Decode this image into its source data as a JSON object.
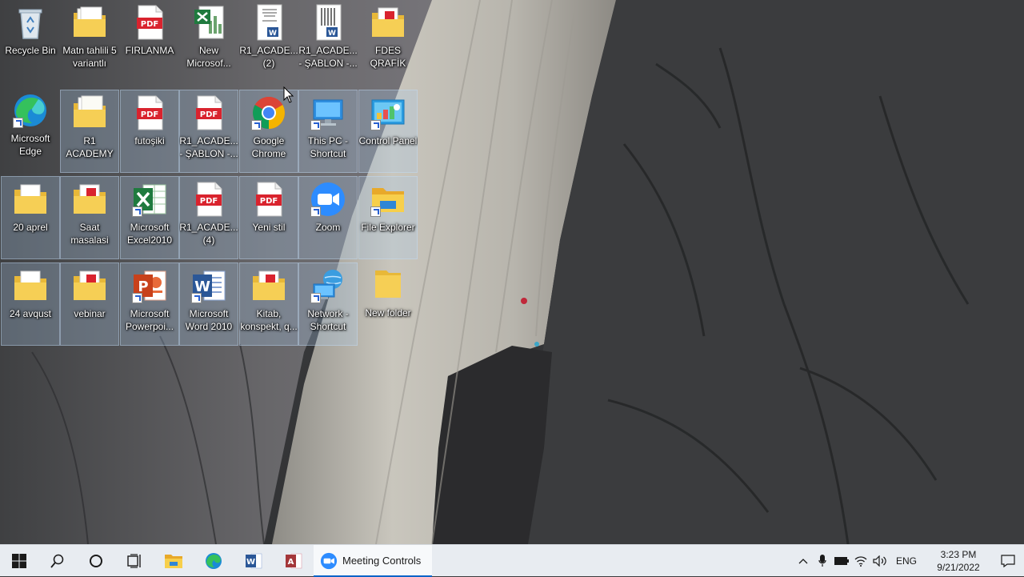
{
  "desktop": {
    "icons": [
      {
        "label": "Recycle Bin"
      },
      {
        "label": "Matn tahlili 5 variantlı"
      },
      {
        "label": "FIRLANMA"
      },
      {
        "label": "New Microsof..."
      },
      {
        "label": "R1_ACADE... (2)"
      },
      {
        "label": "R1_ACADE... - ŞABLON -..."
      },
      {
        "label": "FDES QRAFİK"
      },
      {
        "label": "Microsoft Edge"
      },
      {
        "label": "R1 ACADEMY"
      },
      {
        "label": "futoşiki"
      },
      {
        "label": "R1_ACADE... - ŞABLON -..."
      },
      {
        "label": "Google Chrome"
      },
      {
        "label": "This PC - Shortcut"
      },
      {
        "label": "Control Panel"
      },
      {
        "label": "20 aprel"
      },
      {
        "label": "Saat masalasi"
      },
      {
        "label": "Microsoft Excel2010"
      },
      {
        "label": "R1_ACADE... (4)"
      },
      {
        "label": "Yeni stil"
      },
      {
        "label": "Zoom"
      },
      {
        "label": "File Explorer"
      },
      {
        "label": "24 avqust"
      },
      {
        "label": "vebinar"
      },
      {
        "label": "Microsoft Powerpoi..."
      },
      {
        "label": "Microsoft Word 2010"
      },
      {
        "label": "Kitab, konspekt, q..."
      },
      {
        "label": "Network - Shortcut"
      },
      {
        "label": "New folder"
      }
    ],
    "pdf_badge": "PDF"
  },
  "taskbar": {
    "running_window": "Meeting Controls",
    "language": "ENG",
    "time": "3:23 PM",
    "date": "9/21/2022"
  },
  "colors": {
    "taskbar_bg": "#e8ecf1",
    "accent": "#0a64c8",
    "pdf_red": "#d9232e",
    "folder_yellow": "#f4c542"
  }
}
